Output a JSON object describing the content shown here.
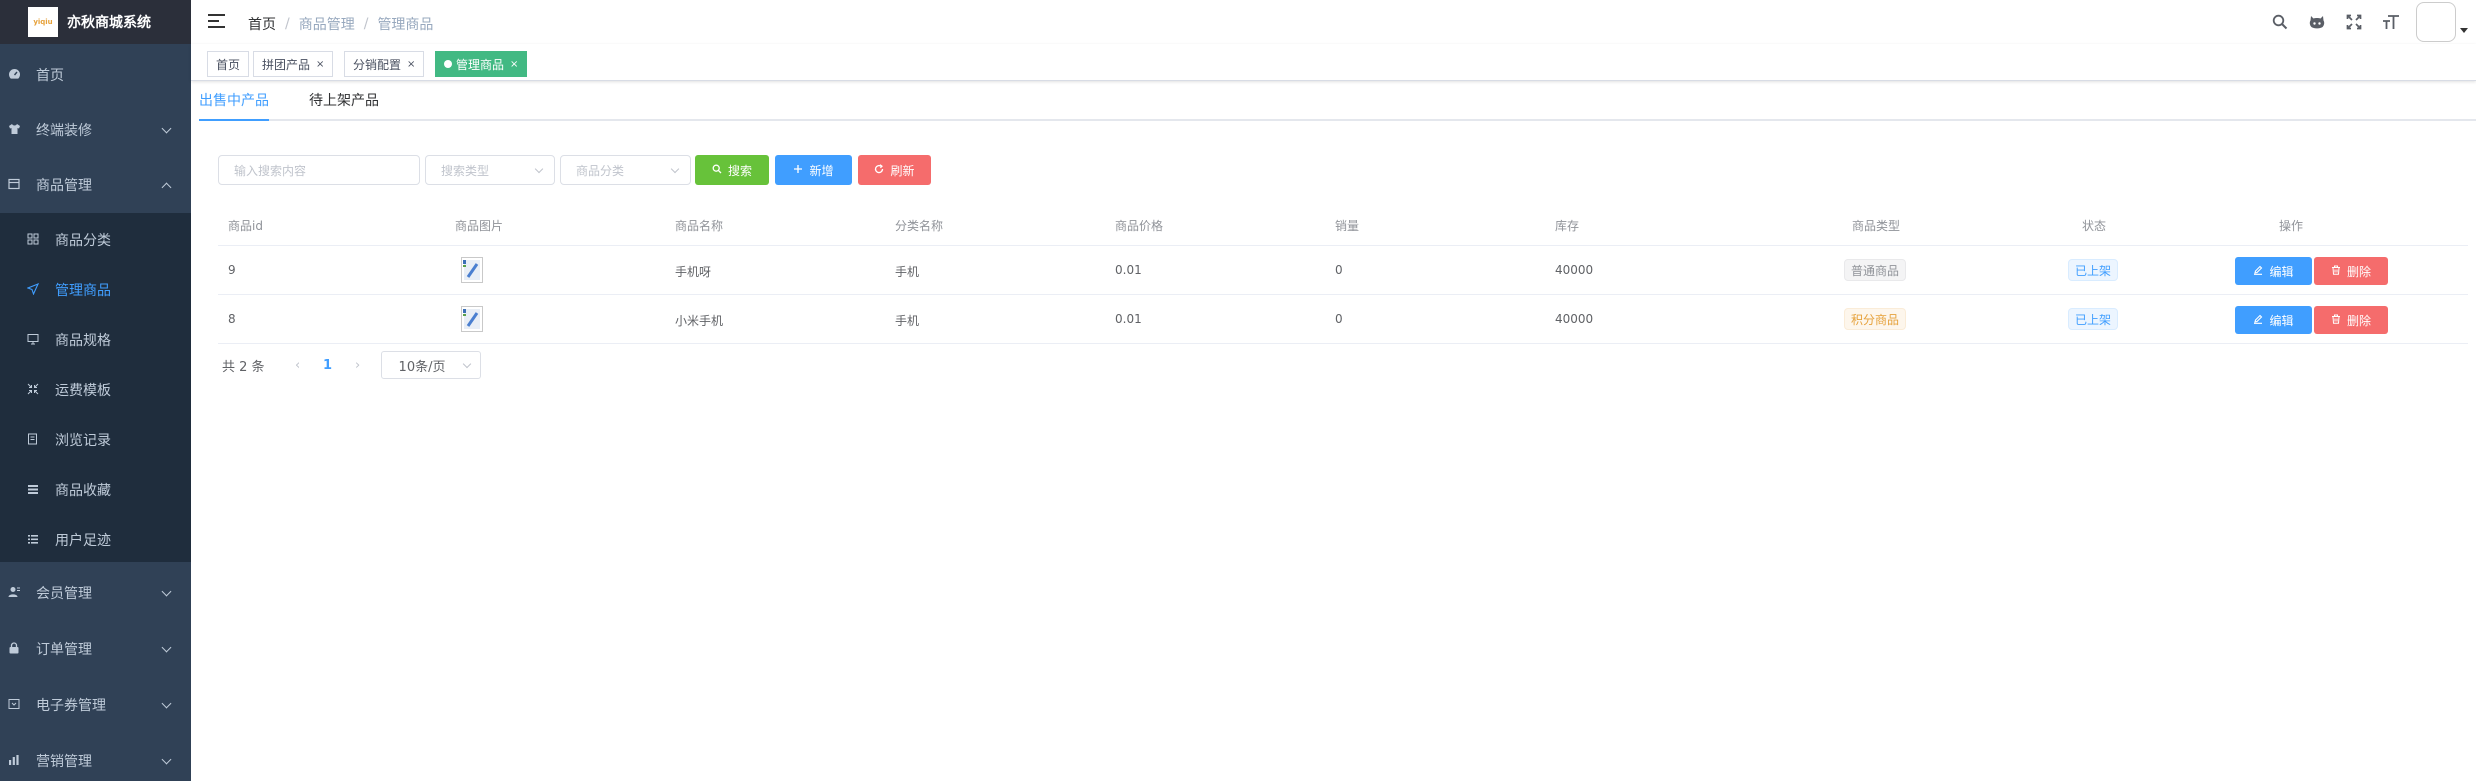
{
  "app": {
    "title": "亦秋商城系统",
    "logo_text": "yiqiu"
  },
  "colors": {
    "sidebar_bg": "#304156",
    "accent": "#409eff",
    "success": "#67c23a",
    "danger": "#f56c6c",
    "tag_active": "#42b983"
  },
  "sidebar": {
    "items": [
      {
        "label": "首页",
        "icon": "dashboard-icon"
      },
      {
        "label": "终端装修",
        "icon": "shirt-icon"
      },
      {
        "label": "商品管理",
        "icon": "goods-icon",
        "expanded": true
      },
      {
        "label": "会员管理",
        "icon": "user-icon"
      },
      {
        "label": "订单管理",
        "icon": "lock-icon"
      },
      {
        "label": "电子券管理",
        "icon": "coupon-icon"
      },
      {
        "label": "营销管理",
        "icon": "chart-icon"
      }
    ],
    "submenu": [
      {
        "label": "商品分类",
        "icon": "grid-icon"
      },
      {
        "label": "管理商品",
        "icon": "send-icon",
        "active": true
      },
      {
        "label": "商品规格",
        "icon": "monitor-icon"
      },
      {
        "label": "运费模板",
        "icon": "shrink-icon"
      },
      {
        "label": "浏览记录",
        "icon": "log-icon"
      },
      {
        "label": "商品收藏",
        "icon": "list-icon"
      },
      {
        "label": "用户足迹",
        "icon": "list-icon"
      }
    ]
  },
  "navbar": {
    "breadcrumb": [
      "首页",
      "商品管理",
      "管理商品"
    ],
    "right_icons": [
      "search-icon",
      "github-icon",
      "fullscreen-icon",
      "font-size-icon"
    ]
  },
  "tags": [
    {
      "label": "首页",
      "closable": false
    },
    {
      "label": "拼团产品",
      "closable": true
    },
    {
      "label": "分销配置",
      "closable": true
    },
    {
      "label": "管理商品",
      "closable": true,
      "active": true
    }
  ],
  "tabs": [
    {
      "label": "出售中产品",
      "active": true
    },
    {
      "label": "待上架产品",
      "active": false
    }
  ],
  "filters": {
    "keyword_placeholder": "输入搜索内容",
    "search_type_placeholder": "搜索类型",
    "category_placeholder": "商品分类",
    "search_label": "搜索",
    "add_label": "新增",
    "refresh_label": "刷新"
  },
  "table": {
    "columns": [
      "商品id",
      "商品图片",
      "商品名称",
      "分类名称",
      "商品价格",
      "销量",
      "库存",
      "商品类型",
      "状态",
      "操作"
    ],
    "rows": [
      {
        "id": "9",
        "name": "手机呀",
        "category": "手机",
        "price": "0.01",
        "sales": "0",
        "stock": "40000",
        "type": "普通商品",
        "status": "已上架"
      },
      {
        "id": "8",
        "name": "小米手机",
        "category": "手机",
        "price": "0.01",
        "sales": "0",
        "stock": "40000",
        "type": "积分商品",
        "status": "已上架"
      }
    ],
    "edit_label": "编辑",
    "delete_label": "删除"
  },
  "pagination": {
    "total_text": "共 2 条",
    "current_page": "1",
    "page_size": "10条/页"
  }
}
